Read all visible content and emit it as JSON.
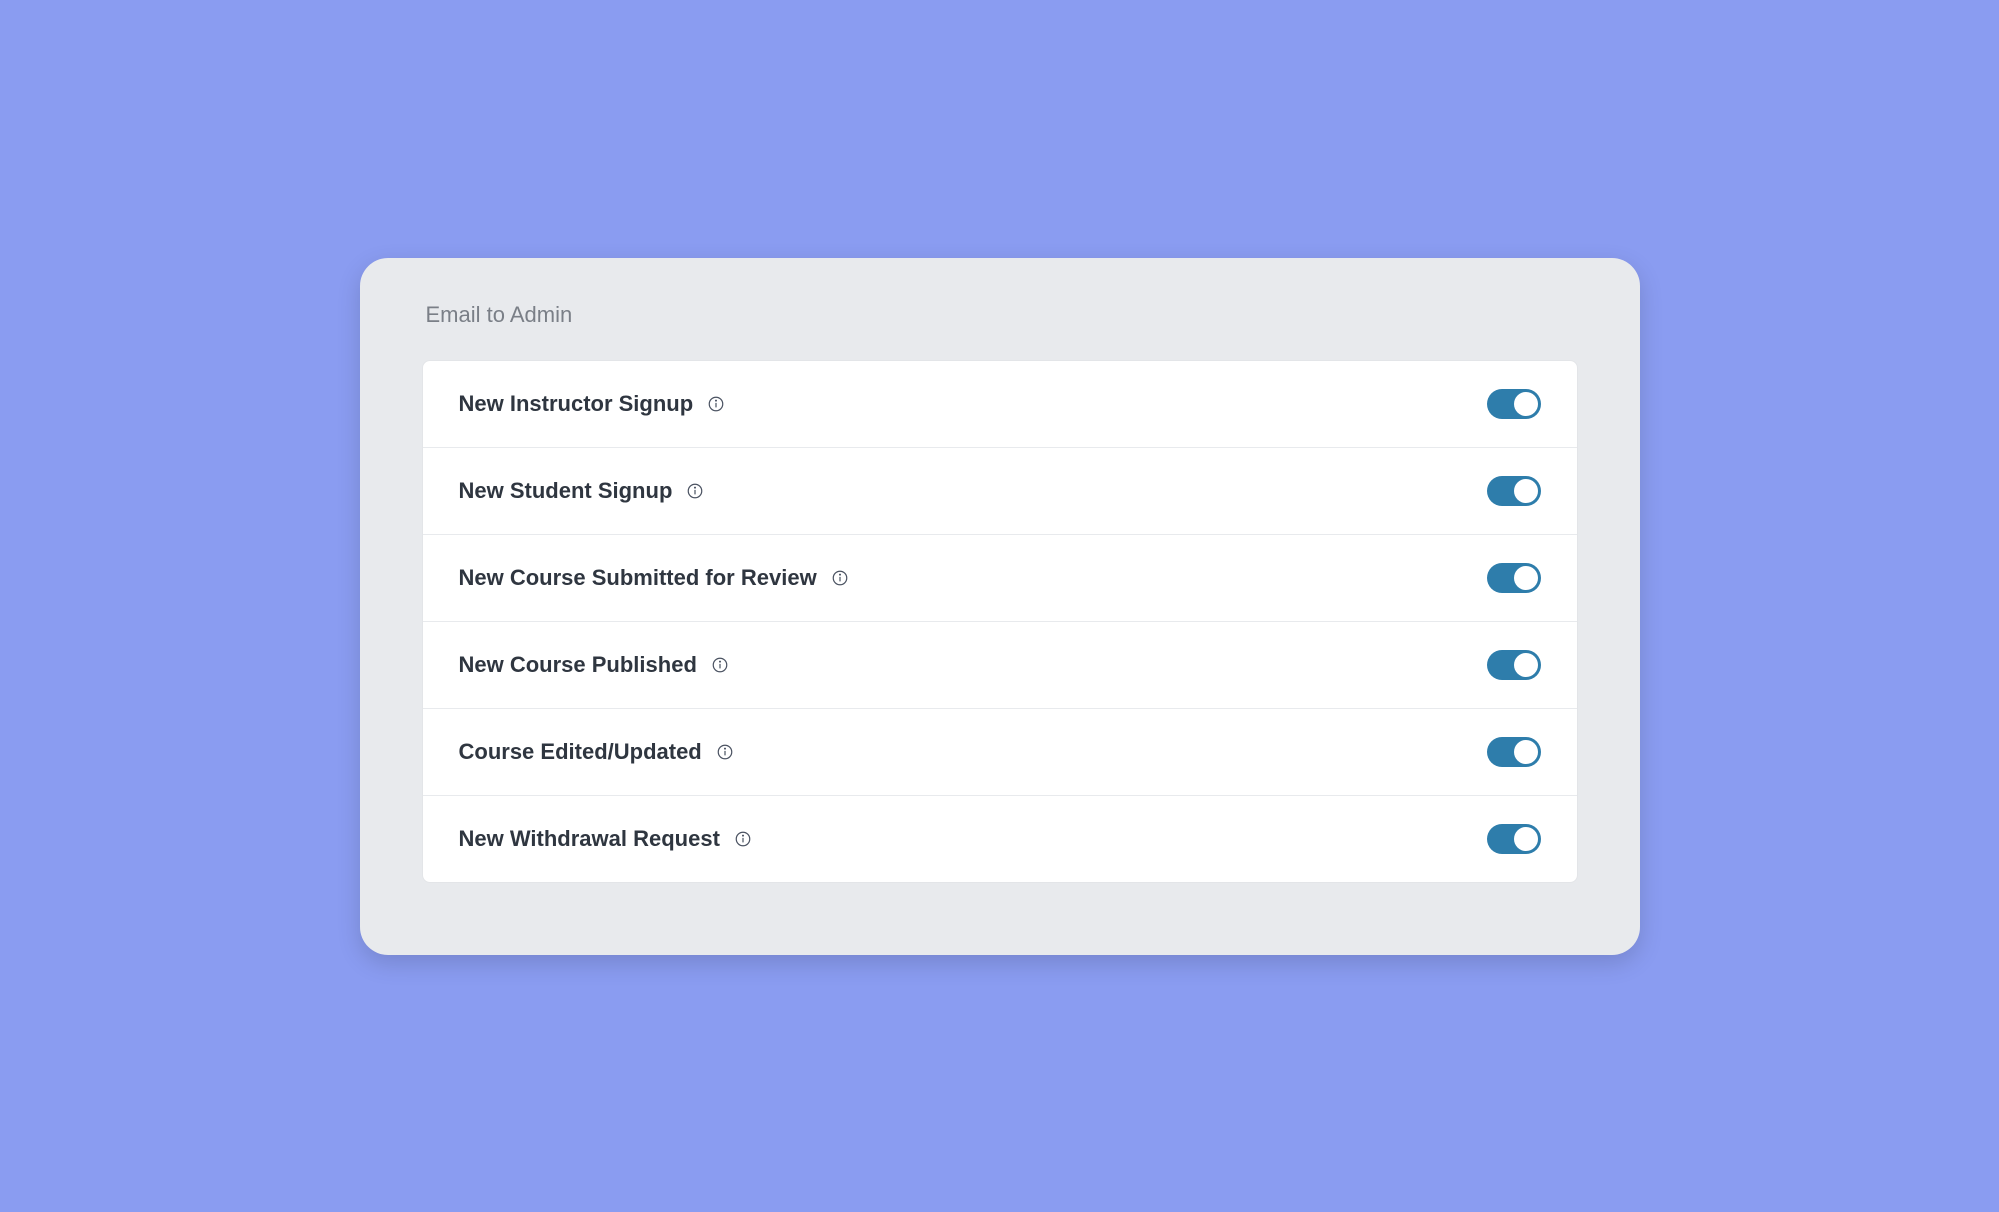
{
  "section": {
    "title": "Email to Admin"
  },
  "settings": [
    {
      "label": "New Instructor Signup",
      "enabled": true
    },
    {
      "label": "New Student Signup",
      "enabled": true
    },
    {
      "label": "New Course Submitted for Review",
      "enabled": true
    },
    {
      "label": "New Course Published",
      "enabled": true
    },
    {
      "label": "Course Edited/Updated",
      "enabled": true
    },
    {
      "label": "New Withdrawal Request",
      "enabled": true
    }
  ]
}
